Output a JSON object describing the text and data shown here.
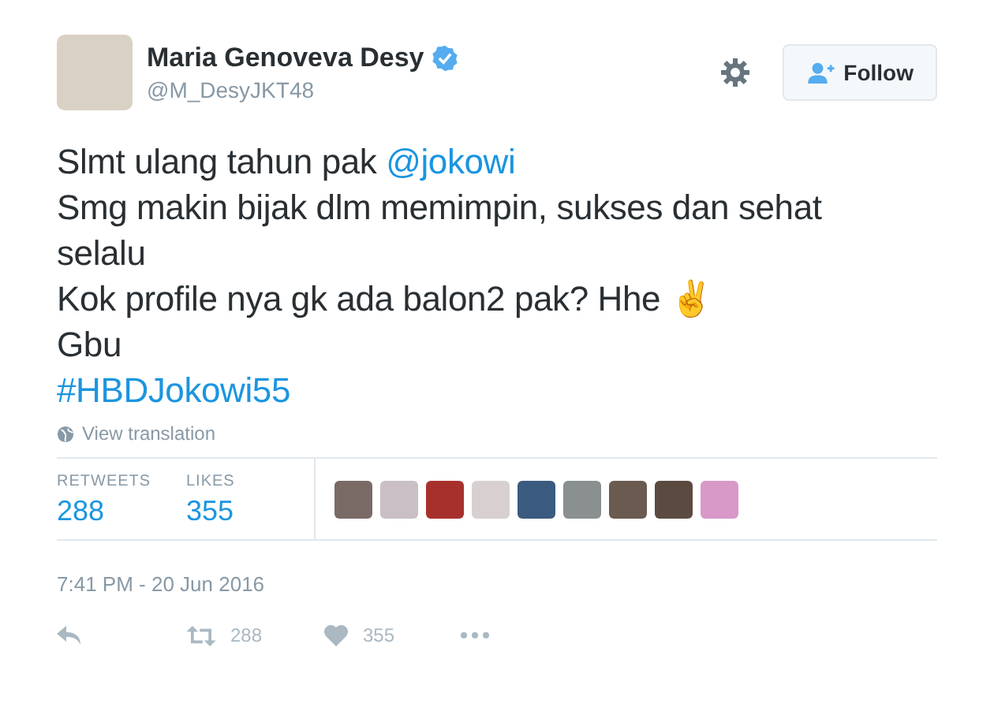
{
  "author": {
    "name": "Maria Genoveva Desy",
    "verified": true,
    "handle": "@M_DesyJKT48"
  },
  "follow_button": {
    "label": "Follow"
  },
  "tweet": {
    "segments": [
      {
        "kind": "text",
        "text": "Slmt ulang tahun pak "
      },
      {
        "kind": "link",
        "text": "@jokowi"
      },
      {
        "kind": "break"
      },
      {
        "kind": "text",
        "text": "Smg makin bijak dlm memimpin, sukses dan sehat selalu"
      },
      {
        "kind": "break"
      },
      {
        "kind": "text",
        "text": "Kok profile nya gk ada balon2 pak? Hhe ✌"
      },
      {
        "kind": "break"
      },
      {
        "kind": "text",
        "text": "Gbu"
      },
      {
        "kind": "break"
      },
      {
        "kind": "link",
        "text": "#HBDJokowi55"
      }
    ]
  },
  "translation_link": "View translation",
  "stats": [
    {
      "label": "RETWEETS",
      "value": "288"
    },
    {
      "label": "LIKES",
      "value": "355"
    }
  ],
  "likers": [
    {
      "color": "#7a6a66"
    },
    {
      "color": "#c9bfc4"
    },
    {
      "color": "#a8302c"
    },
    {
      "color": "#d8d0d0"
    },
    {
      "color": "#3a5a80"
    },
    {
      "color": "#8a8f90"
    },
    {
      "color": "#6a5a50"
    },
    {
      "color": "#5a4a40"
    },
    {
      "color": "#d898c8"
    }
  ],
  "timestamp": "7:41 PM - 20 Jun 2016",
  "actions": [
    {
      "kind": "reply"
    },
    {
      "kind": "retweet",
      "count": "288"
    },
    {
      "kind": "like",
      "count": "355"
    },
    {
      "kind": "more"
    }
  ]
}
